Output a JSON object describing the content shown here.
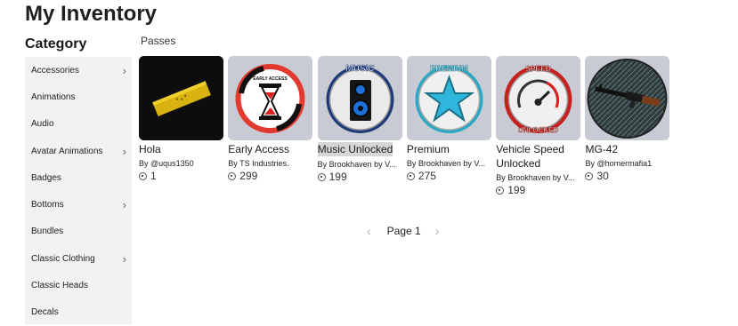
{
  "page": {
    "title": "My Inventory"
  },
  "sidebar": {
    "heading": "Category",
    "items": [
      {
        "label": "Accessories",
        "chevron": true
      },
      {
        "label": "Animations",
        "chevron": false
      },
      {
        "label": "Audio",
        "chevron": false
      },
      {
        "label": "Avatar Animations",
        "chevron": true
      },
      {
        "label": "Badges",
        "chevron": false
      },
      {
        "label": "Bottoms",
        "chevron": true
      },
      {
        "label": "Bundles",
        "chevron": false
      },
      {
        "label": "Classic Clothing",
        "chevron": true
      },
      {
        "label": "Classic Heads",
        "chevron": false
      },
      {
        "label": "Decals",
        "chevron": false
      }
    ]
  },
  "section": {
    "label": "Passes"
  },
  "items": [
    {
      "name": "Hola",
      "creator": "By @uqus1350",
      "price": "1",
      "icon": "gold-bar-icon"
    },
    {
      "name": "Early Access",
      "creator": "By TS Industries.",
      "price": "299",
      "icon": "hourglass-icon"
    },
    {
      "name": "Music Unlocked",
      "creator": "By Brookhaven by V...",
      "price": "199",
      "icon": "speaker-icon"
    },
    {
      "name": "Premium",
      "creator": "By Brookhaven by V...",
      "price": "275",
      "icon": "star-icon"
    },
    {
      "name": "Vehicle Speed Unlocked",
      "creator": "By Brookhaven by V...",
      "price": "199",
      "icon": "speedometer-icon"
    },
    {
      "name": "MG-42",
      "creator": "By @homermafia1",
      "price": "30",
      "icon": "machine-gun-icon"
    }
  ],
  "pagination": {
    "label": "Page 1",
    "prev": "‹",
    "next": "›"
  },
  "thumbs": {
    "music_text": "MUSIC",
    "premium_text": "PREMIUM",
    "speed_top": "SPEED",
    "speed_bottom": "UNLOCKED",
    "early_text": "EARLY ACCESS"
  }
}
